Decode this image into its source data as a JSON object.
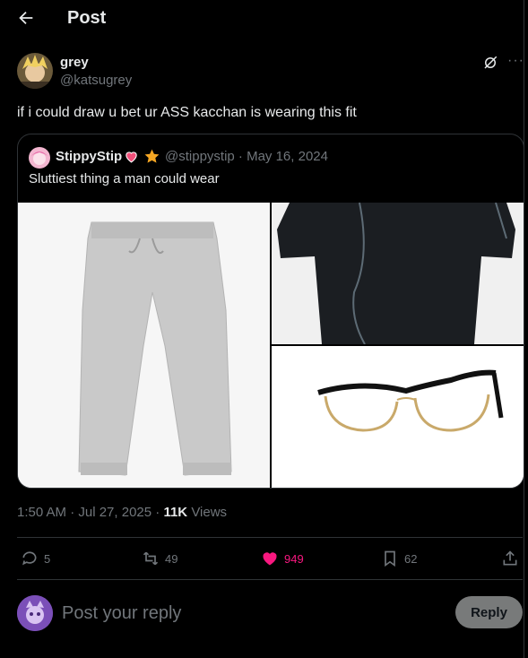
{
  "header": {
    "title": "Post"
  },
  "post": {
    "author_name": "grey",
    "author_handle": "@katsugrey",
    "text": "if i could draw u bet ur ASS kacchan is wearing this fit",
    "timestamp": "1:50 AM · Jul 27, 2025 · ",
    "views_count": "11K",
    "views_label": "Views"
  },
  "quote": {
    "author_name": "StippyStip",
    "meta": "@stippystip · May 16, 2024",
    "text": "Sluttiest thing a man could wear"
  },
  "actions": {
    "replies": "5",
    "reposts": "49",
    "likes": "949",
    "bookmarks": "62"
  },
  "reply": {
    "placeholder": "Post your reply",
    "button": "Reply"
  },
  "colors": {
    "like": "#f91880",
    "muted": "#71767b",
    "text": "#e7e9ea",
    "border": "#2f3336",
    "reply_button": "#787a7a"
  }
}
